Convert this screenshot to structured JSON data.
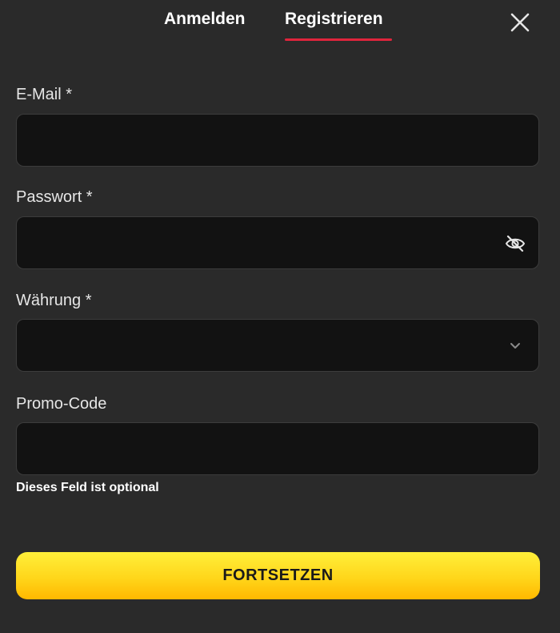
{
  "tabs": {
    "login_label": "Anmelden",
    "register_label": "Registrieren",
    "active": "register"
  },
  "close": {
    "icon": "close-icon"
  },
  "form": {
    "email": {
      "label": "E-Mail *",
      "value": "",
      "placeholder": ""
    },
    "password": {
      "label": "Passwort *",
      "value": "",
      "placeholder": "",
      "toggle_icon": "eye-off-icon"
    },
    "currency": {
      "label": "Währung *",
      "selected": "",
      "icon": "chevron-down-icon"
    },
    "promo": {
      "label": "Promo-Code",
      "value": "",
      "placeholder": "",
      "helper": "Dieses Feld ist optional"
    }
  },
  "submit": {
    "label": "FORTSETZEN"
  },
  "colors": {
    "background": "#2a2a2a",
    "input_background": "#121212",
    "accent_underline": "#e0243c",
    "button_yellow": "#ffd61a"
  }
}
